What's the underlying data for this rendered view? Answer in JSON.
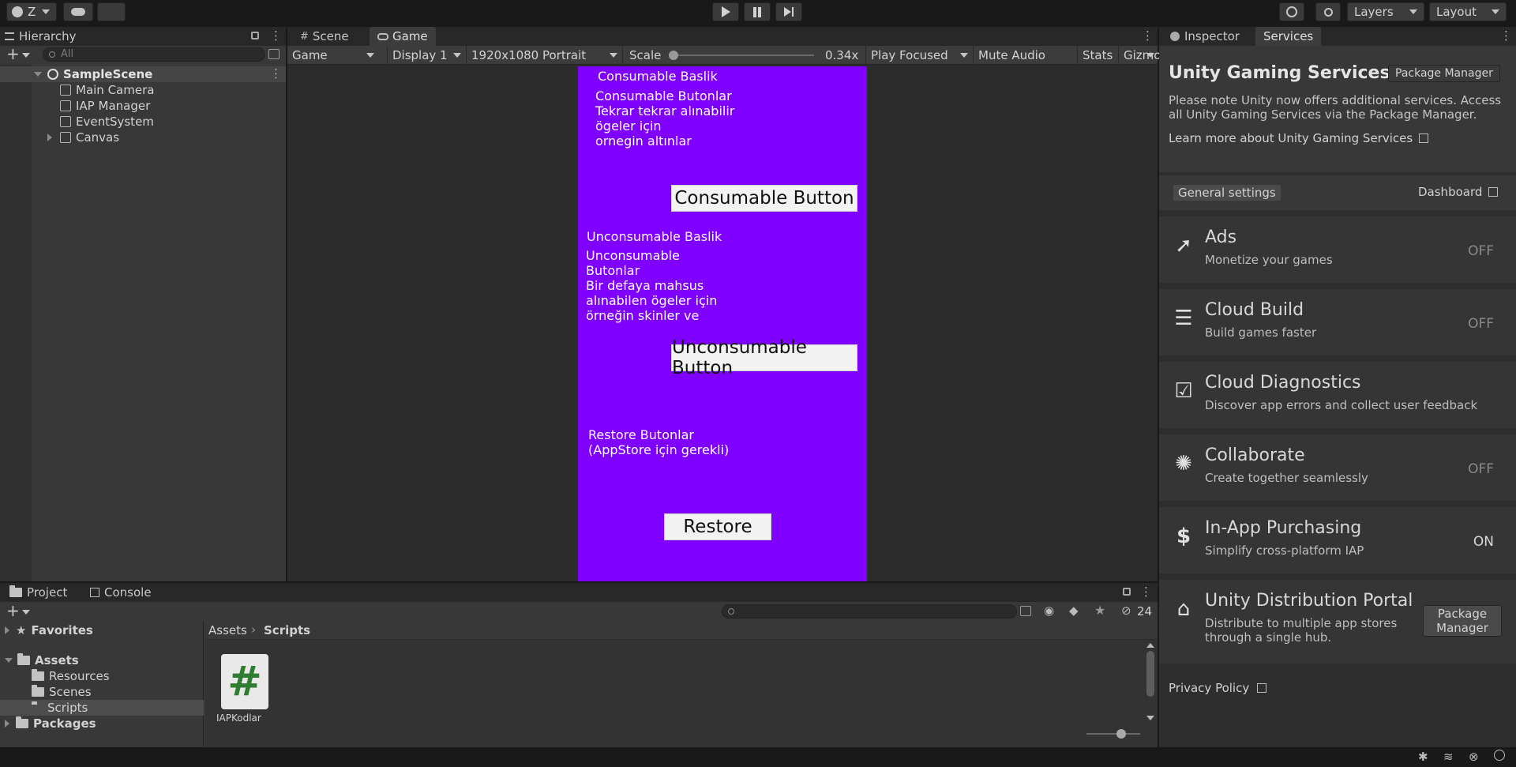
{
  "toolbar": {
    "account_label": "Z",
    "layers_label": "Layers",
    "layout_label": "Layout"
  },
  "hierarchy": {
    "tab_label": "Hierarchy",
    "search_placeholder": "All",
    "scene_name": "SampleScene",
    "items": [
      "Main Camera",
      "IAP Manager",
      "EventSystem",
      "Canvas"
    ]
  },
  "view_tabs": {
    "scene_label": "Scene",
    "game_label": "Game"
  },
  "game_toolbar": {
    "mode": "Game",
    "display": "Display 1",
    "resolution": "1920x1080 Portrait",
    "scale_label": "Scale",
    "scale_value": "0.34x",
    "scale_fraction": 0.03,
    "play_focused": "Play Focused",
    "mute_audio": "Mute Audio",
    "stats": "Stats",
    "gizmos": "Gizmos"
  },
  "game_view": {
    "background_color": "#8000ff",
    "consumable_heading": "Consumable Baslik",
    "consumable_text": "Consumable Butonlar\nTekrar tekrar alınabilir\nögeler için\nornegin altınlar",
    "consumable_button": "Consumable Button",
    "unconsumable_heading": "Unconsumable Baslik",
    "unconsumable_text": "Unconsumable\nButonlar\nBir defaya mahsus\nalınabilen ögeler için\nörneğin skinler ve",
    "unconsumable_button": "Unconsumable Button",
    "restore_text": "Restore Butonlar\n(AppStore için gerekli)",
    "restore_button": "Restore"
  },
  "inspector": {
    "inspector_tab": "Inspector",
    "services_tab": "Services",
    "title": "Unity Gaming Services",
    "package_manager_button": "Package Manager",
    "note": "Please note Unity now offers additional services. Access all Unity Gaming Services via the Package Manager.",
    "learn_more": "Learn more about Unity Gaming Services",
    "general_settings": "General settings",
    "dashboard": "Dashboard",
    "services": [
      {
        "title": "Ads",
        "desc": "Monetize your games",
        "state": "OFF",
        "icon": "ads-icon"
      },
      {
        "title": "Cloud Build",
        "desc": "Build games faster",
        "state": "OFF",
        "icon": "cloud-build-icon"
      },
      {
        "title": "Cloud Diagnostics",
        "desc": "Discover app errors and collect user feedback",
        "state": "",
        "icon": "clipboard-check-icon"
      },
      {
        "title": "Collaborate",
        "desc": "Create together seamlessly",
        "state": "OFF",
        "icon": "collaborate-icon"
      },
      {
        "title": "In-App Purchasing",
        "desc": "Simplify cross-platform IAP",
        "state": "ON",
        "icon": "dollar-icon"
      }
    ],
    "udp": {
      "title": "Unity Distribution Portal",
      "desc": "Distribute to multiple app stores\nthrough a single hub.",
      "button": "Package\nManager"
    },
    "privacy_policy": "Privacy Policy"
  },
  "project": {
    "project_tab": "Project",
    "console_tab": "Console",
    "hidden_count": "24",
    "favorites": "Favorites",
    "assets": "Assets",
    "folders": [
      "Resources",
      "Scenes",
      "Scripts"
    ],
    "packages": "Packages",
    "breadcrumb_root": "Assets",
    "breadcrumb_current": "Scripts",
    "file_name": "IAPKodlar"
  }
}
